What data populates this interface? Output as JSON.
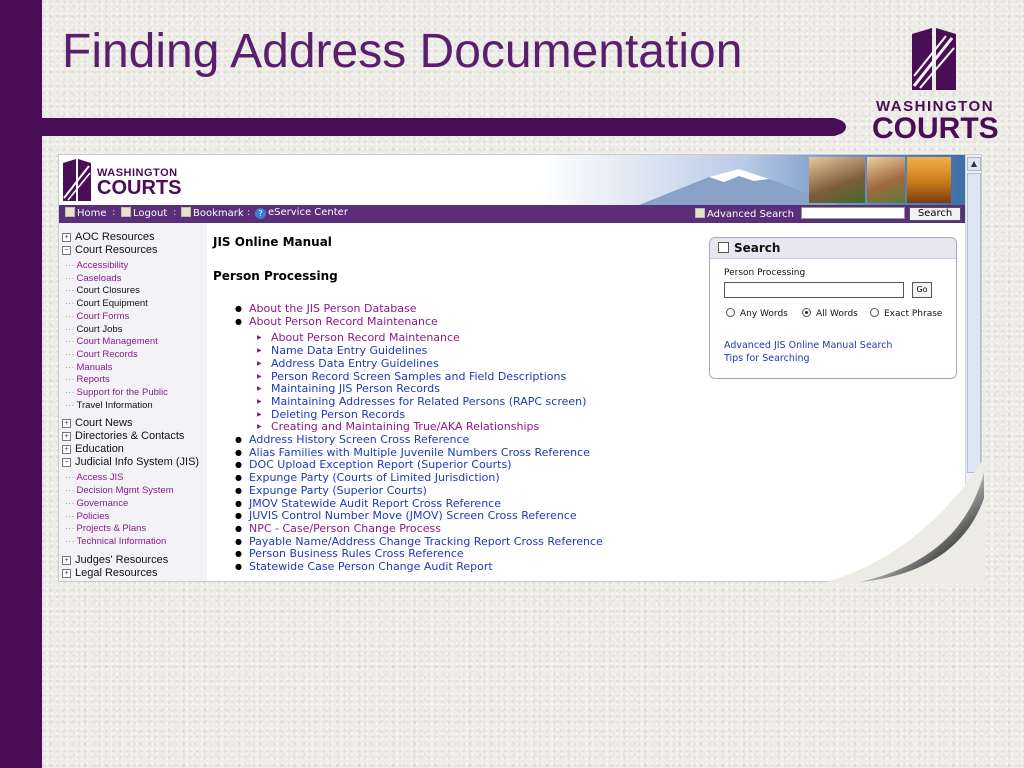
{
  "slide": {
    "title": "Finding Address Documentation",
    "logo": {
      "line1": "WASHINGTON",
      "line2": "COURTS"
    },
    "colors": {
      "brand_purple": "#4a0e56",
      "title_purple": "#5b1e6e",
      "link_blue": "#1f3ab8",
      "visited_purple": "#8a1a8a"
    }
  },
  "site": {
    "logo": {
      "line1": "WASHINGTON",
      "line2": "COURTS"
    },
    "nav": {
      "home": "Home",
      "logout": "Logout",
      "bookmark": "Bookmark",
      "eservice": "eService Center",
      "separator": ":",
      "advanced_search": "Advanced Search",
      "search_button": "Search",
      "search_value": ""
    },
    "sidebar": {
      "top_items": [
        {
          "label": "AOC Resources",
          "toggle": "+"
        },
        {
          "label": "Court Resources",
          "toggle": "−"
        }
      ],
      "court_resources_children": [
        {
          "label": "Accessibility",
          "visited": true
        },
        {
          "label": "Caseloads",
          "visited": true
        },
        {
          "label": "Court Closures",
          "visited": false
        },
        {
          "label": "Court Equipment",
          "visited": false
        },
        {
          "label": "Court Forms",
          "visited": true
        },
        {
          "label": "Court Jobs",
          "visited": false
        },
        {
          "label": "Court Management",
          "visited": true
        },
        {
          "label": "Court Records",
          "visited": true
        },
        {
          "label": "Manuals",
          "visited": true
        },
        {
          "label": "Reports",
          "visited": true
        },
        {
          "label": "Support for the Public",
          "visited": true
        },
        {
          "label": "Travel Information",
          "visited": false
        }
      ],
      "mid_items": [
        {
          "label": "Court News",
          "toggle": "+"
        },
        {
          "label": "Directories & Contacts",
          "toggle": "+"
        },
        {
          "label": "Education",
          "toggle": "+"
        },
        {
          "label": "Judicial Info System (JIS)",
          "toggle": "−"
        }
      ],
      "jis_children": [
        {
          "label": "Access JIS",
          "visited": true
        },
        {
          "label": "Decision Mgmt System",
          "visited": true
        },
        {
          "label": "Governance",
          "visited": true
        },
        {
          "label": "Policies",
          "visited": true
        },
        {
          "label": "Projects & Plans",
          "visited": true
        },
        {
          "label": "Technical Information",
          "visited": true
        }
      ],
      "bottom_items": [
        {
          "label": "Judges' Resources",
          "toggle": "+"
        },
        {
          "label": "Legal Resources",
          "toggle": "+"
        }
      ]
    },
    "content": {
      "manual_title": "JIS Online Manual",
      "section_title": "Person Processing",
      "links_top": [
        {
          "label": "About the JIS Person Database",
          "visited": true
        },
        {
          "label": "About Person Record Maintenance",
          "visited": true
        }
      ],
      "sub_links": [
        {
          "label": "About Person Record Maintenance",
          "visited": true
        },
        {
          "label": "Name Data Entry Guidelines",
          "visited": false
        },
        {
          "label": "Address Data Entry Guidelines",
          "visited": false
        },
        {
          "label": "Person Record Screen Samples and Field Descriptions",
          "visited": false
        },
        {
          "label": "Maintaining JIS Person Records",
          "visited": false
        },
        {
          "label": "Maintaining Addresses for Related Persons (RAPC screen)",
          "visited": false
        },
        {
          "label": "Deleting Person Records",
          "visited": false
        },
        {
          "label": "Creating and Maintaining True/AKA Relationships",
          "visited": true
        }
      ],
      "links_bottom": [
        {
          "label": "Address History Screen Cross Reference",
          "visited": false
        },
        {
          "label": "Alias Families with Multiple Juvenile Numbers Cross Reference",
          "visited": false
        },
        {
          "label": "DOC Upload Exception Report (Superior Courts)",
          "visited": false
        },
        {
          "label": "Expunge Party (Courts of Limited Jurisdiction)",
          "visited": false
        },
        {
          "label": "Expunge Party (Superior Courts)",
          "visited": false
        },
        {
          "label": "JMOV Statewide Audit Report Cross Reference",
          "visited": false
        },
        {
          "label": "JUVIS Control Number Move (JMOV) Screen Cross Reference",
          "visited": false
        },
        {
          "label": "NPC - Case/Person Change Process",
          "visited": true
        },
        {
          "label": "Payable Name/Address Change Tracking Report Cross Reference",
          "visited": false
        },
        {
          "label": "Person Business Rules Cross Reference",
          "visited": false
        },
        {
          "label": "Statewide Case Person Change Audit Report",
          "visited": false
        }
      ]
    },
    "search_panel": {
      "title": "Search",
      "scope": "Person Processing",
      "input_value": "",
      "go_label": "Go",
      "options": [
        {
          "label": "Any Words",
          "selected": false
        },
        {
          "label": "All Words",
          "selected": true
        },
        {
          "label": "Exact Phrase",
          "selected": false
        }
      ],
      "advanced_link": "Advanced JIS Online Manual Search",
      "tips_link": "Tips for Searching"
    }
  }
}
